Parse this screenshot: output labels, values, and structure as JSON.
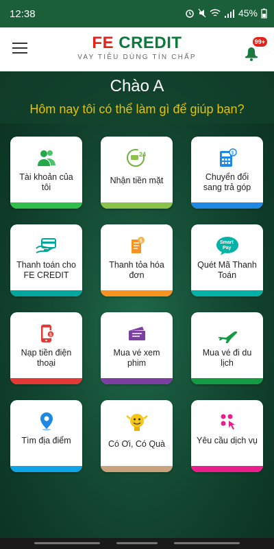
{
  "status_bar": {
    "time": "12:38",
    "battery": "45%"
  },
  "app_bar": {
    "brand_fe": "FE",
    "brand_credit": "CREDIT",
    "tagline": "VAY TIÊU DÙNG TÍN CHẤP",
    "notification_count": "99+"
  },
  "hero": {
    "greeting": "Chào A",
    "question": "Hôm nay tôi có thể làm gì để giúp bạn?"
  },
  "tiles": [
    {
      "label": "Tài khoản của tôi",
      "icon": "users-icon",
      "color": "#2fbf4a"
    },
    {
      "label": "Nhận tiền mặt",
      "icon": "cash-24-icon",
      "color": "#8bc34a"
    },
    {
      "label": "Chuyển đổi sang trả góp",
      "icon": "calculator-icon",
      "color": "#1e88e5"
    },
    {
      "label": "Thanh toán cho FE CREDIT",
      "icon": "card-payment-icon",
      "color": "#00a79d"
    },
    {
      "label": "Thanh tỏa hóa đơn",
      "icon": "bill-icon",
      "color": "#f7931e"
    },
    {
      "label": "Quét Mã Thanh Toán",
      "icon": "smartpay-icon",
      "color": "#00b3a6"
    },
    {
      "label": "Nạp tiền điện thoại",
      "icon": "phone-topup-icon",
      "color": "#e53935"
    },
    {
      "label": "Mua vé xem phim",
      "icon": "movie-ticket-icon",
      "color": "#7b3fa0"
    },
    {
      "label": "Mua vé đi du lịch",
      "icon": "airplane-icon",
      "color": "#139a43"
    },
    {
      "label": "Tìm địa điểm",
      "icon": "location-pin-icon",
      "color": "#0fa3e8"
    },
    {
      "label": "Có Ơi, Có Quà",
      "icon": "mascot-icon",
      "color": "#c9a27c"
    },
    {
      "label": "Yêu cầu dịch vụ",
      "icon": "service-request-icon",
      "color": "#e91e8c"
    }
  ]
}
